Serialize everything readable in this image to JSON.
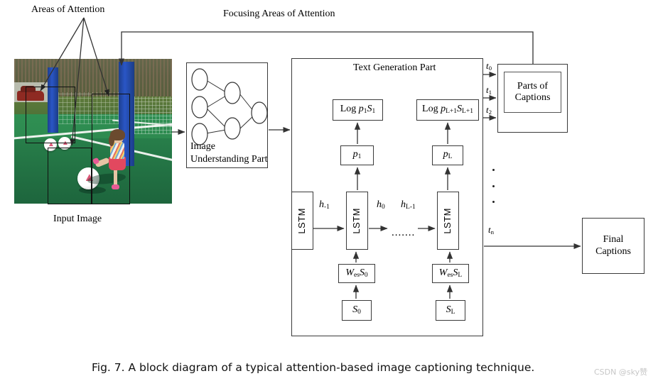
{
  "figure": {
    "caption": "Fig. 7.  A block diagram of a typical attention-based image captioning technique.",
    "watermark": "CSDN @sky赞"
  },
  "annotations": {
    "areas_of_attention": "Areas of Attention",
    "focusing_areas_of_attention": "Focusing  Areas of Attention",
    "input_image": "Input Image"
  },
  "image_understanding": {
    "title_line1": "Image",
    "title_line2": "Understanding  Part",
    "nodes": {
      "input_layer": 3,
      "hidden_layer": 2,
      "output_layer": 1
    }
  },
  "text_generation": {
    "title": "Text Generation  Part",
    "log_boxes": [
      "Log p1S1",
      "Log pL+1SL+1"
    ],
    "prob_boxes": [
      "p1",
      "pL"
    ],
    "lstm_boxes": [
      "LSTM",
      "LSTM",
      "LSTM"
    ],
    "embedding_boxes": [
      "WesS0",
      "WesSL"
    ],
    "word_boxes": [
      "S0",
      "SL"
    ],
    "hidden_labels": [
      "h-1",
      "h0",
      "hL-1"
    ],
    "ellipsis": "......."
  },
  "outputs": {
    "time_labels": [
      "t0",
      "t1",
      "t2",
      "tn"
    ],
    "parts_of_captions_line1": "Parts of",
    "parts_of_captions_line2": "Captions",
    "final_captions_line1": "Final",
    "final_captions_line2": "Captions"
  },
  "colors": {
    "stroke": "#3a3a3a",
    "text": "#000000",
    "court_green": "#2f8f52",
    "post_blue": "#2a56c6",
    "watermark_gray": "#c7c7c7"
  }
}
